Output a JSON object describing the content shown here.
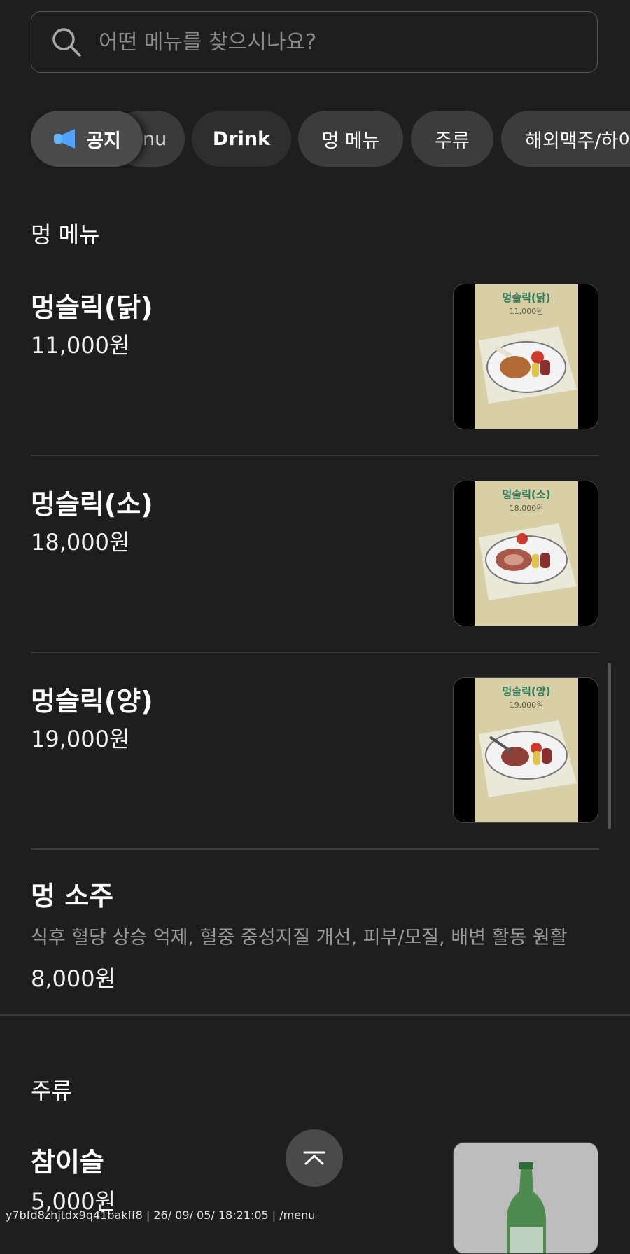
{
  "search": {
    "placeholder": "어떤 메뉴를 찾으시나요?"
  },
  "chips": [
    {
      "label": "공지",
      "icon": "megaphone-icon"
    },
    {
      "label": "nu"
    },
    {
      "label": "Drink"
    },
    {
      "label": "멍 메뉴"
    },
    {
      "label": "주류"
    },
    {
      "label": "해외맥주/하이"
    }
  ],
  "sections": {
    "meong": {
      "title": "멍 메뉴",
      "items": [
        {
          "name": "멍슬릭(닭)",
          "price": "11,000원",
          "poster_title": "멍슬릭(닭)",
          "poster_price": "11,000원"
        },
        {
          "name": "멍슬릭(소)",
          "price": "18,000원",
          "poster_title": "멍슬릭(소)",
          "poster_price": "18,000원"
        },
        {
          "name": "멍슬릭(양)",
          "price": "19,000원",
          "poster_title": "멍슬릭(양)",
          "poster_price": "19,000원"
        },
        {
          "name": "멍 소주",
          "desc": "식후 혈당 상승 억제, 혈중 중성지질 개선, 피부/모질, 배변 활동 원활",
          "price": "8,000원"
        }
      ]
    },
    "liquor": {
      "title": "주류",
      "items": [
        {
          "name": "참이슬",
          "price": "5,000원"
        }
      ]
    }
  },
  "footer": "y7bfd8zhjtdx9q41bakff8 | 26/ 09/ 05/ 18:21:05 | /menu",
  "colors": {
    "background": "#1e1e1e",
    "chip": "#3c3c3c",
    "poster": "#d8cfa6",
    "poster_title": "#2f7a5a",
    "notice_icon": "#4da3ff"
  }
}
